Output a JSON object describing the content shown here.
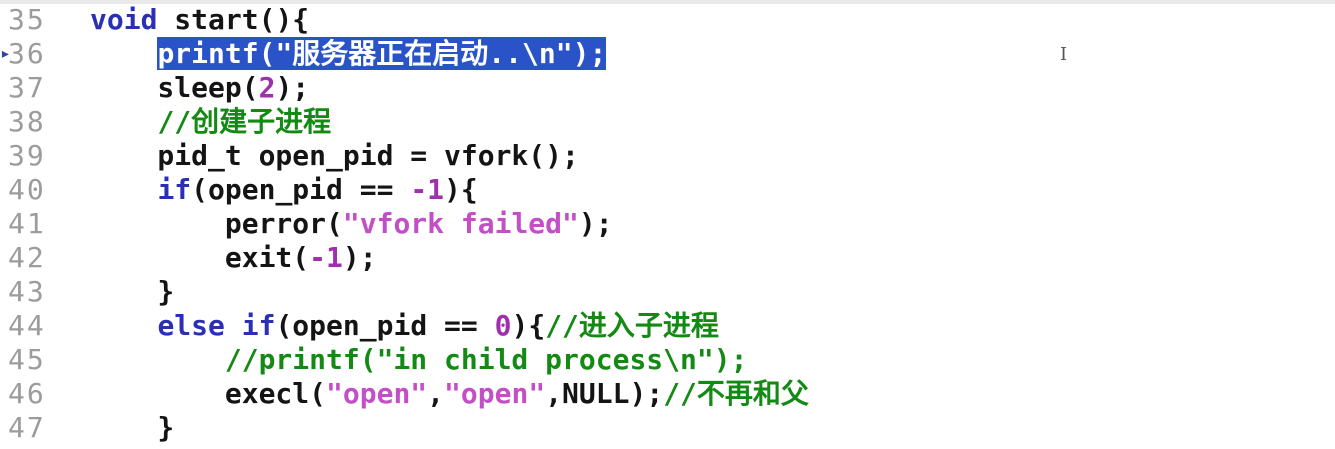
{
  "editor": {
    "lines": [
      {
        "num": "35",
        "parts": [
          {
            "t": "void",
            "c": "kw"
          },
          {
            "t": " start(){",
            "c": ""
          }
        ]
      },
      {
        "num": "36",
        "parts": [
          {
            "t": "    ",
            "c": ""
          },
          {
            "t": "printf(\"服务器正在启动..\\n\");",
            "c": "sel"
          }
        ]
      },
      {
        "num": "37",
        "parts": [
          {
            "t": "    sleep(",
            "c": ""
          },
          {
            "t": "2",
            "c": "num"
          },
          {
            "t": ");",
            "c": ""
          }
        ]
      },
      {
        "num": "38",
        "parts": [
          {
            "t": "    ",
            "c": ""
          },
          {
            "t": "//创建子进程",
            "c": "cm"
          }
        ]
      },
      {
        "num": "39",
        "parts": [
          {
            "t": "    pid_t open_pid = vfork();",
            "c": ""
          }
        ]
      },
      {
        "num": "40",
        "parts": [
          {
            "t": "    ",
            "c": ""
          },
          {
            "t": "if",
            "c": "kw"
          },
          {
            "t": "(open_pid == ",
            "c": ""
          },
          {
            "t": "-1",
            "c": "num"
          },
          {
            "t": "){",
            "c": ""
          }
        ]
      },
      {
        "num": "41",
        "parts": [
          {
            "t": "        perror(",
            "c": ""
          },
          {
            "t": "\"vfork failed\"",
            "c": "str"
          },
          {
            "t": ");",
            "c": ""
          }
        ]
      },
      {
        "num": "42",
        "parts": [
          {
            "t": "        exit(",
            "c": ""
          },
          {
            "t": "-1",
            "c": "num"
          },
          {
            "t": ");",
            "c": ""
          }
        ]
      },
      {
        "num": "43",
        "parts": [
          {
            "t": "    }",
            "c": ""
          }
        ]
      },
      {
        "num": "44",
        "parts": [
          {
            "t": "    ",
            "c": ""
          },
          {
            "t": "else if",
            "c": "kw"
          },
          {
            "t": "(open_pid == ",
            "c": ""
          },
          {
            "t": "0",
            "c": "num"
          },
          {
            "t": "){",
            "c": ""
          },
          {
            "t": "//进入子进程",
            "c": "cm"
          }
        ]
      },
      {
        "num": "45",
        "parts": [
          {
            "t": "        ",
            "c": ""
          },
          {
            "t": "//printf(\"in child process\\n\");",
            "c": "cm"
          }
        ]
      },
      {
        "num": "46",
        "parts": [
          {
            "t": "        execl(",
            "c": ""
          },
          {
            "t": "\"open\"",
            "c": "str"
          },
          {
            "t": ",",
            "c": ""
          },
          {
            "t": "\"open\"",
            "c": "str"
          },
          {
            "t": ",NULL);",
            "c": ""
          },
          {
            "t": "//不再和父",
            "c": "cm"
          }
        ]
      },
      {
        "num": "47",
        "parts": [
          {
            "t": "    }",
            "c": ""
          }
        ]
      }
    ],
    "breakpoint_line": "36",
    "cursor_glyph": "I",
    "bookmark_glyph": "▸"
  },
  "colors": {
    "keyword": "#2b2fb5",
    "string": "#c24fc6",
    "number": "#a02fb0",
    "comment": "#138a13",
    "selection": "#2a53c8",
    "line_number": "#9c9c9c"
  }
}
